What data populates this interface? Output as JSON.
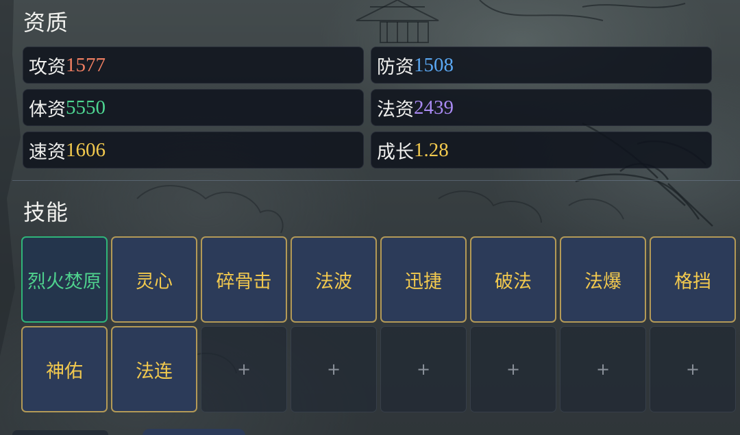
{
  "sections": {
    "attributes_title": "资质",
    "skills_title": "技能"
  },
  "attributes": [
    {
      "label": "攻资",
      "value": "1577",
      "color": "#f07f62"
    },
    {
      "label": "防资",
      "value": "1508",
      "color": "#5aa7f2"
    },
    {
      "label": "体资",
      "value": "5550",
      "color": "#4ed792"
    },
    {
      "label": "法资",
      "value": "2439",
      "color": "#a98af3"
    },
    {
      "label": "速资",
      "value": "1606",
      "color": "#f2c94e"
    },
    {
      "label": "成长",
      "value": "1.28",
      "color": "#f2c94e"
    }
  ],
  "skills": [
    {
      "name": "烈火焚原",
      "state": "active"
    },
    {
      "name": "灵心",
      "state": "filled"
    },
    {
      "name": "碎骨击",
      "state": "filled"
    },
    {
      "name": "法波",
      "state": "filled"
    },
    {
      "name": "迅捷",
      "state": "filled"
    },
    {
      "name": "破法",
      "state": "filled"
    },
    {
      "name": "法爆",
      "state": "filled"
    },
    {
      "name": "格挡",
      "state": "filled"
    },
    {
      "name": "神佑",
      "state": "filled"
    },
    {
      "name": "法连",
      "state": "filled"
    },
    {
      "name": "+",
      "state": "empty"
    },
    {
      "name": "+",
      "state": "empty"
    },
    {
      "name": "+",
      "state": "empty"
    },
    {
      "name": "+",
      "state": "empty"
    },
    {
      "name": "+",
      "state": "empty"
    },
    {
      "name": "+",
      "state": "empty"
    }
  ]
}
